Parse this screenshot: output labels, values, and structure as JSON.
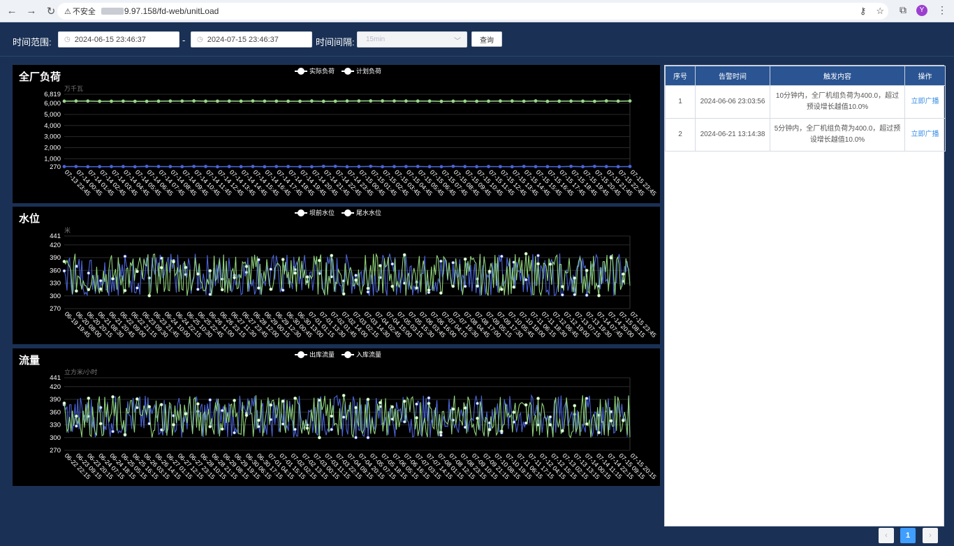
{
  "browser": {
    "back": "←",
    "forward": "→",
    "reload": "↻",
    "warning_icon": "⚠",
    "not_secure": "不安全",
    "url": "9.97.158/fd-web/unitLoad",
    "key_icon": "⚷",
    "star_icon": "☆",
    "extension_icon": "⧉",
    "profile_initial": "Y",
    "menu_icon": "⋮"
  },
  "filters": {
    "time_range_label": "时间范围:",
    "start": "2024-06-15 23:46:37",
    "separator": "-",
    "end": "2024-07-15 23:46:37",
    "interval_label": "时间间隔:",
    "interval_value": "15min",
    "query_button": "查询"
  },
  "charts": [
    {
      "title": "全厂负荷",
      "unit": "万千瓦",
      "legend": [
        "实际负荷",
        "计划负荷"
      ],
      "y_ticks": [
        6819,
        6000,
        5000,
        4000,
        3000,
        2000,
        1000,
        270
      ],
      "y_labels": [
        "6,819",
        "6,000",
        "5,000",
        "4,000",
        "3,000",
        "2,000",
        "1,000",
        "270"
      ],
      "ylim": [
        270,
        6819
      ],
      "x_labels": [
        "07-13 23:45",
        "07-14 00:45",
        "07-14 01:45",
        "07-14 02:45",
        "07-14 03:45",
        "07-14 04:45",
        "07-14 05:45",
        "07-14 06:45",
        "07-14 07:45",
        "07-14 08:45",
        "07-14 09:45",
        "07-14 10:45",
        "07-14 11:45",
        "07-14 12:45",
        "07-14 13:45",
        "07-14 14:45",
        "07-14 15:45",
        "07-14 16:45",
        "07-14 17:45",
        "07-14 18:45",
        "07-14 19:45",
        "07-14 20:45",
        "07-14 21:45",
        "07-14 22:45",
        "07-14 23:45",
        "07-15 00:45",
        "07-15 01:45",
        "07-15 02:45",
        "07-15 03:45",
        "07-15 04:45",
        "07-15 05:45",
        "07-15 06:45",
        "07-15 07:45",
        "07-15 08:45",
        "07-15 09:45",
        "07-15 10:45",
        "07-15 11:45",
        "07-15 12:45",
        "07-15 13:45",
        "07-15 14:45",
        "07-15 15:45",
        "07-15 16:45",
        "07-15 17:45",
        "07-15 18:45",
        "07-15 19:45",
        "07-15 20:45",
        "07-15 21:45",
        "07-15 22:45",
        "07-15 23:45"
      ]
    },
    {
      "title": "水位",
      "unit": "米",
      "legend": [
        "坝前水位",
        "尾水水位"
      ],
      "y_ticks": [
        441,
        420,
        390,
        360,
        330,
        300,
        270
      ],
      "y_labels": [
        "441",
        "420",
        "390",
        "360",
        "330",
        "300",
        "270"
      ],
      "ylim": [
        270,
        441
      ],
      "x_labels": [
        "06-19 19:45",
        "06-20 08:00",
        "06-20 20:15",
        "06-21 08:30",
        "06-21 20:45",
        "06-22 09:00",
        "06-22 21:15",
        "06-23 09:30",
        "06-23 21:45",
        "06-24 10:00",
        "06-24 22:15",
        "06-25 10:30",
        "06-25 22:45",
        "06-26 11:00",
        "06-26 23:15",
        "06-27 11:30",
        "06-27 23:45",
        "06-28 12:00",
        "06-29 00:15",
        "06-29 12:30",
        "06-30 00:45",
        "06-30 13:00",
        "07-01 01:15",
        "07-01 13:30",
        "07-02 01:45",
        "07-02 14:00",
        "07-03 02:15",
        "07-03 14:30",
        "07-04 02:45",
        "07-04 15:00",
        "07-05 03:15",
        "07-05 15:30",
        "07-06 03:45",
        "07-06 16:00",
        "07-07 04:15",
        "07-07 16:30",
        "07-08 04:45",
        "07-08 17:00",
        "07-09 05:15",
        "07-09 17:30",
        "07-10 05:45",
        "07-10 18:00",
        "07-11 06:15",
        "07-11 18:30",
        "07-12 06:45",
        "07-12 19:00",
        "07-13 07:15",
        "07-13 19:30",
        "07-14 07:45",
        "07-14 20:00",
        "07-15 08:15",
        "07-15 23:45"
      ]
    },
    {
      "title": "流量",
      "unit": "立方米/小时",
      "legend": [
        "出库流量",
        "入库流量"
      ],
      "y_ticks": [
        441,
        420,
        390,
        360,
        330,
        300,
        270
      ],
      "y_labels": [
        "441",
        "420",
        "390",
        "360",
        "330",
        "300",
        "270"
      ],
      "ylim": [
        270,
        441
      ],
      "x_labels": [
        "06-22 22:15",
        "06-23 09:15",
        "06-23 20:15",
        "06-24 07:15",
        "06-24 18:15",
        "06-25 05:15",
        "06-25 16:15",
        "06-26 03:15",
        "06-26 14:15",
        "06-27 01:15",
        "06-27 12:15",
        "06-27 23:15",
        "06-28 10:15",
        "06-28 21:15",
        "06-29 08:15",
        "06-29 19:15",
        "06-30 06:15",
        "06-30 17:15",
        "07-01 04:15",
        "07-01 15:15",
        "07-02 02:15",
        "07-02 13:15",
        "07-03 00:15",
        "07-03 11:15",
        "07-03 22:15",
        "07-04 09:15",
        "07-04 20:15",
        "07-05 07:15",
        "07-05 18:15",
        "07-06 05:15",
        "07-06 16:15",
        "07-07 03:15",
        "07-07 14:15",
        "07-08 01:15",
        "07-08 12:15",
        "07-08 23:15",
        "07-09 10:15",
        "07-09 21:15",
        "07-10 08:15",
        "07-10 19:15",
        "07-11 06:15",
        "07-11 17:15",
        "07-12 04:15",
        "07-12 15:15",
        "07-13 02:15",
        "07-13 13:15",
        "07-14 00:15",
        "07-14 11:15",
        "07-14 22:15",
        "07-15 09:15",
        "07-15 20:15"
      ]
    }
  ],
  "chart_data": [
    {
      "type": "line",
      "title": "全厂负荷",
      "ylabel": "万千瓦",
      "ylim": [
        270,
        6819
      ],
      "series": [
        {
          "name": "实际负荷",
          "color": "#4a64d6",
          "constant": 300
        },
        {
          "name": "计划负荷",
          "color": "#9bd88a",
          "constant": 6200
        }
      ]
    },
    {
      "type": "line",
      "title": "水位",
      "ylabel": "米",
      "ylim": [
        270,
        441
      ],
      "series": [
        {
          "name": "坝前水位",
          "color": "#4a64d6",
          "range": [
            300,
            400
          ]
        },
        {
          "name": "尾水水位",
          "color": "#8fd27a",
          "range": [
            300,
            400
          ]
        }
      ]
    },
    {
      "type": "line",
      "title": "流量",
      "ylabel": "立方米/小时",
      "ylim": [
        270,
        441
      ],
      "series": [
        {
          "name": "出库流量",
          "color": "#4a64d6",
          "range": [
            300,
            400
          ]
        },
        {
          "name": "入库流量",
          "color": "#8fd27a",
          "range": [
            300,
            400
          ]
        }
      ]
    }
  ],
  "table": {
    "headers": [
      "序号",
      "告警时间",
      "触发内容",
      "操作"
    ],
    "rows": [
      {
        "index": "1",
        "time": "2024-06-06 23:03:56",
        "content": "10分钟内，全厂机组负荷为400.0，超过预设增长越值10.0%",
        "action": "立即广播"
      },
      {
        "index": "2",
        "time": "2024-06-21 13:14:38",
        "content": "5分钟内，全厂机组负荷为400.0，超过预设增长越值10.0%",
        "action": "立即广播"
      }
    ]
  },
  "pagination": {
    "prev": "‹",
    "current": "1",
    "next": "›"
  }
}
